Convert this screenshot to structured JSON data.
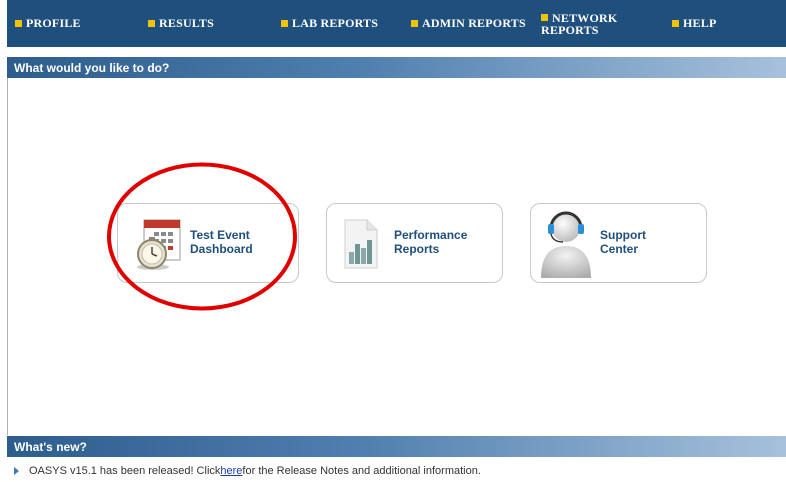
{
  "nav": {
    "profile": "PROFILE",
    "results": "RESULTS",
    "lab_reports": "LAB REPORTS",
    "admin_reports": "ADMIN REPORTS",
    "network_line1": "NETWORK",
    "network_line2": "REPORTS",
    "help": "HELP"
  },
  "sections": {
    "what_to_do": "What would you like to do?",
    "whats_new": "What's new?"
  },
  "tiles": [
    {
      "line1": "Test Event",
      "line2": "Dashboard",
      "icon": "calendar-clock-icon"
    },
    {
      "line1": "Performance",
      "line2": "Reports",
      "icon": "bar-chart-document-icon"
    },
    {
      "line1": "Support",
      "line2": "Center",
      "icon": "headset-user-icon"
    }
  ],
  "news": {
    "before": "OASYS v15.1 has been released! Click ",
    "link": "here",
    "after": " for the Release Notes and additional information."
  },
  "colors": {
    "nav_bg": "#1f4f7d",
    "bullet": "#f2c300",
    "tile_label": "#1f4f7d",
    "annotation": "#e00000"
  }
}
